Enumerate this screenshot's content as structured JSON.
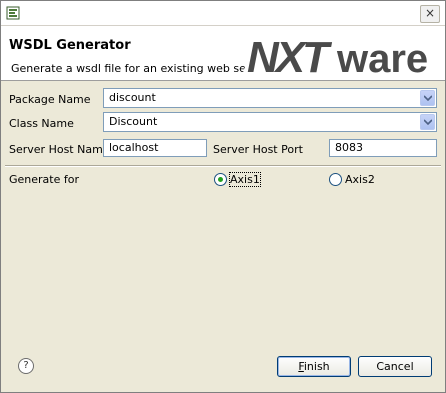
{
  "window": {
    "app_icon": "eclipse-icon",
    "close_glyph": "×"
  },
  "header": {
    "title": "WSDL Generator",
    "subtitle": "Generate a wsdl file for an existing web service",
    "logo_text_nx": "NXT",
    "logo_text_ware": "ware"
  },
  "form": {
    "package_name": {
      "label": "Package Name",
      "value": "discount"
    },
    "class_name": {
      "label": "Class Name",
      "value": "Discount"
    },
    "server_host_name": {
      "label": "Server Host Name",
      "value": "localhost"
    },
    "server_host_port": {
      "label": "Server Host Port",
      "value": "8083"
    },
    "generate_for": {
      "label": "Generate for",
      "options": [
        {
          "label": "Axis1",
          "selected": true
        },
        {
          "label": "Axis2",
          "selected": false
        }
      ]
    }
  },
  "footer": {
    "help_glyph": "?",
    "finish_mnemonic": "F",
    "finish_rest": "inish",
    "cancel_label": "Cancel"
  },
  "colors": {
    "logo_gray": "#4a4a4a",
    "radio_dot": "#21a121",
    "field_border": "#7f9db9"
  }
}
